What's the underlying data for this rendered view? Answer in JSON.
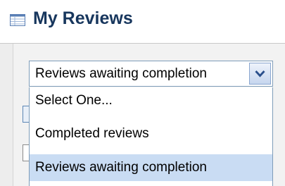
{
  "header": {
    "title": "My Reviews",
    "icon": "list-table-icon"
  },
  "filter": {
    "selected_value": "Reviews awaiting completion",
    "options": [
      "Select One...",
      "Completed reviews",
      "Reviews awaiting completion"
    ],
    "highlighted_index": 2
  },
  "colors": {
    "title": "#17365d",
    "highlight": "#c9dcf3",
    "border": "#7f9db9"
  }
}
